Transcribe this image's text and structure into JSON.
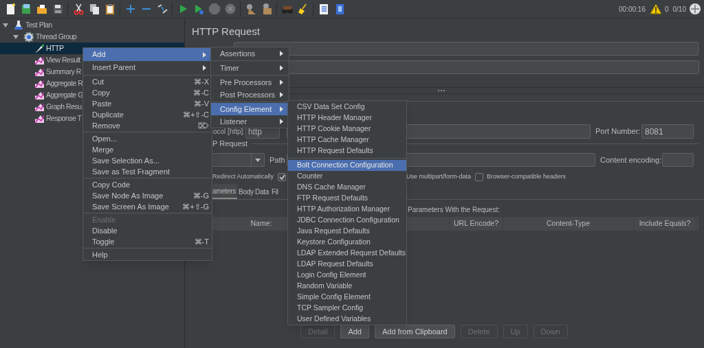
{
  "toolbar": {
    "elapsed": "00:00:16",
    "warnings": "0",
    "threads": "0/10"
  },
  "tree": [
    {
      "label": "Test Plan",
      "kind": "plan",
      "expanded": true,
      "selected": false,
      "children": [
        {
          "label": "Thread Group",
          "kind": "thread_group",
          "expanded": true,
          "selected": false,
          "children": [
            {
              "label": "HTTP",
              "kind": "sampler",
              "selected": true
            },
            {
              "label": "View Result",
              "kind": "listener",
              "selected": false
            },
            {
              "label": "Summary R",
              "kind": "listener",
              "selected": false
            },
            {
              "label": "Aggregate R",
              "kind": "listener",
              "selected": false
            },
            {
              "label": "Aggregate G",
              "kind": "listener",
              "selected": false
            },
            {
              "label": "Graph Resu",
              "kind": "listener",
              "selected": false
            },
            {
              "label": "Response T",
              "kind": "listener",
              "selected": false
            }
          ]
        }
      ]
    }
  ],
  "panel": {
    "title": "HTTP Request",
    "protocol_label": "ocol [http]:",
    "protocol": "http",
    "port_label": "Port Number:",
    "port": "8081",
    "group_label": "P Request",
    "path_label": "Path",
    "encoding_label": "Content encoding:",
    "options": [
      {
        "label": "Redirect Automatically"
      },
      {
        "checked": true
      },
      {
        "label": "Use multipart/form-data"
      },
      {
        "label": "Browser-compatible headers",
        "checked": false
      }
    ],
    "tabs": [
      {
        "label": "ameters",
        "selected": true
      },
      {
        "label": "Body Data",
        "selected": false
      },
      {
        "label": "Fil",
        "selected": false
      }
    ],
    "caption": "Parameters With the Request:",
    "columns": [
      "Name:",
      "URL Encode?",
      "Content-Type",
      "Include Equals?"
    ],
    "buttons": [
      {
        "label": "Detail",
        "disabled": true
      },
      {
        "label": "Add",
        "disabled": false
      },
      {
        "label": "Add from Clipboard",
        "disabled": false
      },
      {
        "label": "Delete",
        "disabled": true
      },
      {
        "label": "Up",
        "disabled": true
      },
      {
        "label": "Down",
        "disabled": true
      }
    ]
  },
  "context_menu": {
    "groups": [
      [
        {
          "label": "Add",
          "submenu": true,
          "selected": true
        },
        {
          "label": "Insert Parent",
          "submenu": true,
          "selected": false
        }
      ],
      [
        {
          "label": "Cut",
          "shortcut": "⌘-X",
          "selected": false
        },
        {
          "label": "Copy",
          "shortcut": "⌘-C",
          "selected": false
        },
        {
          "label": "Paste",
          "shortcut": "⌘-V",
          "selected": false
        },
        {
          "label": "Duplicate",
          "shortcut": "⌘+⇧-C",
          "selected": false
        },
        {
          "label": "Remove",
          "shortcut": "⌦",
          "selected": false
        }
      ],
      [
        {
          "label": "Open...",
          "selected": false
        },
        {
          "label": "Merge",
          "selected": false
        },
        {
          "label": "Save Selection As...",
          "selected": false
        },
        {
          "label": "Save as Test Fragment",
          "selected": false
        }
      ],
      [
        {
          "label": "Copy Code",
          "selected": false
        },
        {
          "label": "Save Node As Image",
          "shortcut": "⌘-G",
          "selected": false
        },
        {
          "label": "Save Screen As Image",
          "shortcut": "⌘+⇧-G",
          "selected": false
        }
      ],
      [
        {
          "label": "Enable",
          "disabled": true,
          "selected": false
        },
        {
          "label": "Disable",
          "disabled": false,
          "selected": false
        },
        {
          "label": "Toggle",
          "shortcut": "⌘-T",
          "disabled": false,
          "selected": false
        }
      ],
      [
        {
          "label": "Help",
          "selected": false
        }
      ]
    ]
  },
  "add_menu": {
    "groups": [
      [
        {
          "label": "Assertions",
          "selected": false
        }
      ],
      [
        {
          "label": "Timer",
          "selected": false
        }
      ],
      [
        {
          "label": "Pre Processors",
          "selected": false
        },
        {
          "label": "Post Processors",
          "selected": false
        }
      ],
      [
        {
          "label": "Config Element",
          "selected": true
        },
        {
          "label": "Listener",
          "selected": false
        }
      ]
    ]
  },
  "config_menu": {
    "groups": [
      [
        {
          "label": "CSV Data Set Config",
          "selected": false
        },
        {
          "label": "HTTP Header Manager",
          "selected": false
        },
        {
          "label": "HTTP Cookie Manager",
          "selected": false
        },
        {
          "label": "HTTP Cache Manager",
          "selected": false
        },
        {
          "label": "HTTP Request Defaults",
          "selected": false
        }
      ],
      [
        {
          "label": "Bolt Connection Configuration",
          "selected": true
        },
        {
          "label": "Counter",
          "selected": false
        },
        {
          "label": "DNS Cache Manager",
          "selected": false
        },
        {
          "label": "FTP Request Defaults",
          "selected": false
        },
        {
          "label": "HTTP Authorization Manager",
          "selected": false
        },
        {
          "label": "JDBC Connection Configuration",
          "selected": false
        },
        {
          "label": "Java Request Defaults",
          "selected": false
        },
        {
          "label": "Keystore Configuration",
          "selected": false
        },
        {
          "label": "LDAP Extended Request Defaults",
          "selected": false
        },
        {
          "label": "LDAP Request Defaults",
          "selected": false
        },
        {
          "label": "Login Config Element",
          "selected": false
        },
        {
          "label": "Random Variable",
          "selected": false
        },
        {
          "label": "Simple Config Element",
          "selected": false
        },
        {
          "label": "TCP Sampler Config",
          "selected": false
        },
        {
          "label": "User Defined Variables",
          "selected": false
        }
      ]
    ]
  }
}
